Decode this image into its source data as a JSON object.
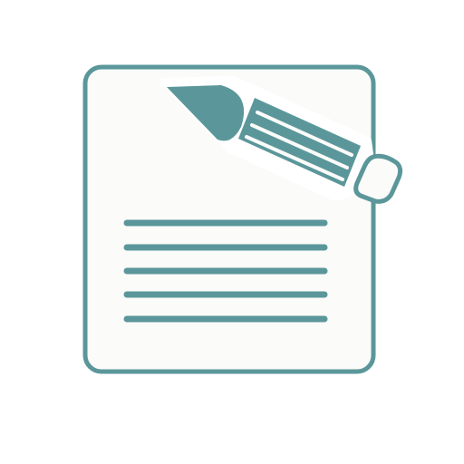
{
  "icon": {
    "name": "edit-document-icon",
    "colors": {
      "accent": "#5b979a",
      "accent_dark": "#4f8a8d",
      "paper": "#fbfbfa",
      "background": "#ffffff"
    },
    "text_line_count": 5
  }
}
